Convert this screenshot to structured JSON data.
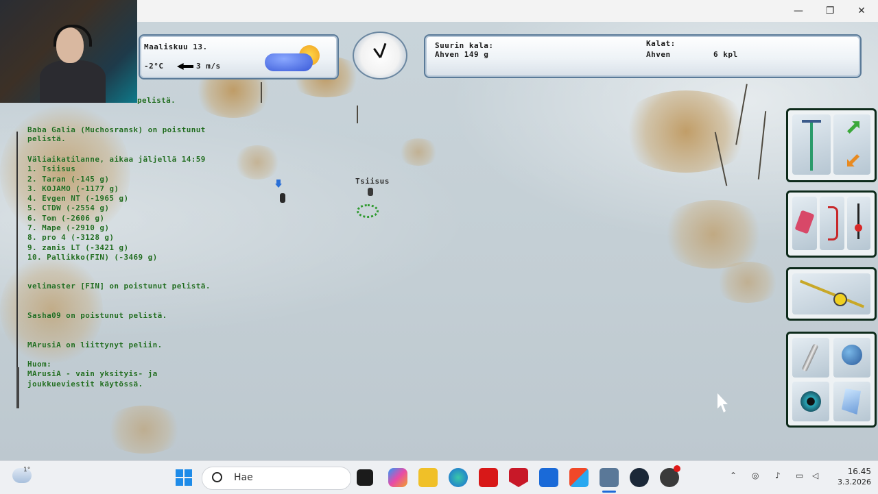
{
  "window": {
    "minimize_glyph": "—",
    "restore_glyph": "❐",
    "close_glyph": "✕"
  },
  "weather": {
    "date": "Maaliskuu 13.",
    "temperature": "-2°C",
    "wind": "3 m/s",
    "icon": "partly-sunny-icon"
  },
  "catch": {
    "biggest_label": "Suurin kala:",
    "biggest_value": "Ahven 149 g",
    "fish_label": "Kalat:",
    "fish_name": "Ahven",
    "fish_count": "6 kpl"
  },
  "chat": {
    "lines": [
      "pelistä.",
      "Baba Galia (Muchosransk) on poistunut\npelistä.",
      "Väliaikatilanne, aikaa jäljellä 14:59\n1. Tsiisus\n2. Taran (-145 g)\n3. KOJAMO (-1177 g)\n4. Evgen NT (-1965 g)\n5. CTDW (-2554 g)\n6. Tom (-2606 g)\n7. Mape (-2910 g)\n8. pro 4 (-3128 g)\n9. zanis LT (-3421 g)\n10. Pallikko(FIN) (-3469 g)",
      "velimaster [FIN] on poistunut pelistä.",
      "Sasha09 on poistunut pelistä.",
      "MArusiA on liittynyt peliin.",
      "Huom:\nMArusiA - vain yksityis- ja\njoukkueviestit käytössä."
    ]
  },
  "player": {
    "name": "Tsiisus"
  },
  "tools": {
    "group1": [
      "ice-drill-icon",
      "arrows-icon"
    ],
    "group2": [
      "lure-box-icon",
      "hook-icon",
      "float-icon"
    ],
    "group3": [
      "fishing-rod-icon"
    ],
    "group4": [
      "knife-icon",
      "globe-icon",
      "eye-icon",
      "ice-shard-icon"
    ]
  },
  "taskbar": {
    "widget_temp": "1°",
    "search_placeholder": "Hae",
    "time": "16.45",
    "date": "3.3.2026",
    "apps": [
      "start-icon",
      "task-view-icon",
      "copilot-icon",
      "file-explorer-icon",
      "edge-icon",
      "lastpass-icon",
      "mcafee-icon",
      "outlook-icon",
      "microsoft-store-icon",
      "game-icon",
      "steam-icon",
      "browser-icon"
    ]
  },
  "colors": {
    "chat_text": "#1f6b1f",
    "hud_border": "#5a7a98",
    "ice": "#c7d1d6"
  }
}
